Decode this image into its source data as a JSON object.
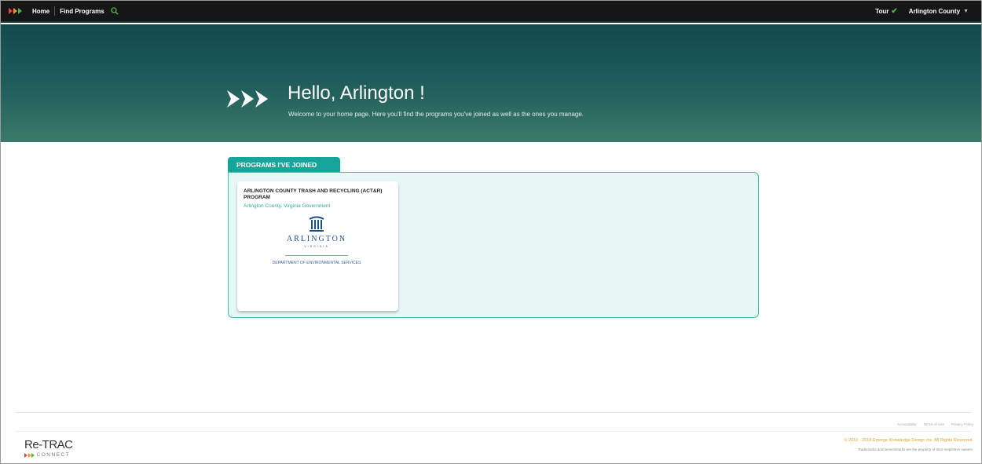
{
  "nav": {
    "home": "Home",
    "find_programs": "Find Programs",
    "tour": "Tour",
    "account": "Arlington County"
  },
  "hero": {
    "title": "Hello, Arlington !",
    "subtitle": "Welcome to your home page. Here you'll find the programs you've joined as well as the ones you manage."
  },
  "programs": {
    "tab_label": "PROGRAMS I'VE JOINED",
    "items": [
      {
        "title": "ARLINGTON COUNTY TRASH AND RECYCLING (ACT&R) PROGRAM",
        "organization": "Arlington County, Virginia Government",
        "logo": {
          "name": "ARLINGTON",
          "state": "VIRGINIA",
          "department": "DEPARTMENT OF ENVIRONMENTAL SERVICES"
        }
      }
    ]
  },
  "footer": {
    "links": [
      "Accessibility",
      "Terms of Use",
      "Privacy Policy"
    ],
    "copyright": "© 2010 - 2018 Emerge Knowledge Design Inc. All Rights Reserved.",
    "trademark": "Trademarks and servicemarks are the property of their respective owners.",
    "brand_name": "Re-TRAC",
    "brand_sub": "CONNECT"
  },
  "colors": {
    "accent": "#17a59b",
    "topbar": "#161616",
    "hero": "#1f5c5b",
    "copyright": "#e5a023"
  }
}
